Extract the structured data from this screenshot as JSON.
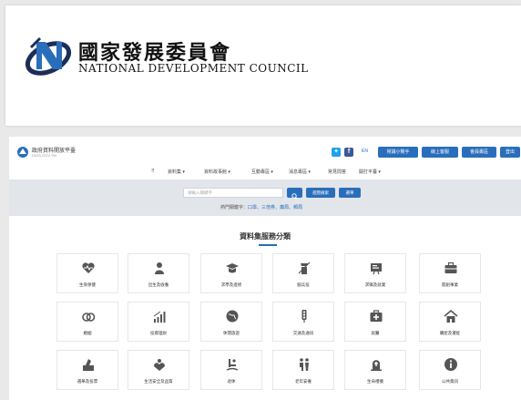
{
  "header": {
    "title_zh": "國家發展委員會",
    "title_en": "NATIONAL DEVELOPMENT COUNCIL"
  },
  "site": {
    "name": "政府資料開放平臺",
    "subtitle": "DATA.GOV.TW",
    "lang": "EN",
    "buttons": [
      "常識小幫手",
      "線上客服",
      "會員專區",
      "登出"
    ],
    "nav": [
      "資料集",
      "資料故事館",
      "互動專區",
      "消息專區",
      "常見問答",
      "開打平臺"
    ],
    "search": {
      "placeholder": "請輸入關鍵字",
      "advanced": "進階檢索",
      "quick": "選單"
    },
    "hot": {
      "label": "熱門關鍵字：",
      "terms": [
        "口罩",
        "三倍券",
        "藥局",
        "郵局"
      ]
    },
    "section_title": "資料集服務分類",
    "categories": [
      {
        "label": "生育保健",
        "icon": "heart-pulse-icon"
      },
      {
        "label": "出生及收養",
        "icon": "baby-icon"
      },
      {
        "label": "求學及進修",
        "icon": "graduation-cap-icon"
      },
      {
        "label": "服兵役",
        "icon": "soldier-icon"
      },
      {
        "label": "求職及就業",
        "icon": "job-board-icon"
      },
      {
        "label": "開創事業",
        "icon": "briefcase-icon"
      },
      {
        "label": "婚姻",
        "icon": "rings-icon"
      },
      {
        "label": "投資理財",
        "icon": "chart-icon"
      },
      {
        "label": "休閒旅遊",
        "icon": "globe-icon"
      },
      {
        "label": "交通及通訊",
        "icon": "traffic-light-icon"
      },
      {
        "label": "就醫",
        "icon": "medical-kit-icon"
      },
      {
        "label": "購屋及遷徙",
        "icon": "house-icon"
      },
      {
        "label": "選舉及投票",
        "icon": "ballot-icon"
      },
      {
        "label": "生活安全及品質",
        "icon": "hands-icon"
      },
      {
        "label": "退休",
        "icon": "rocking-chair-icon"
      },
      {
        "label": "老年安養",
        "icon": "elderly-icon"
      },
      {
        "label": "生命禮儀",
        "icon": "tombstone-icon"
      },
      {
        "label": "公共資訊",
        "icon": "info-icon"
      }
    ]
  },
  "colors": {
    "accent": "#2a6ebb",
    "icon": "#555555",
    "band": "#e2e5ea"
  }
}
